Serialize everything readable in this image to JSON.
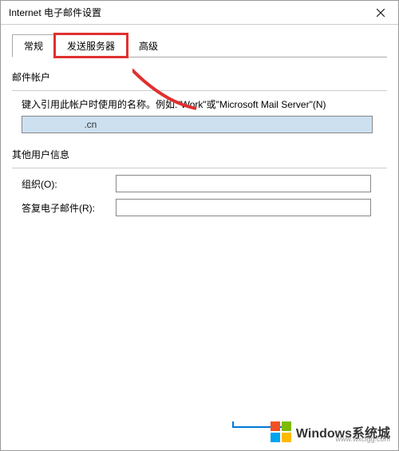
{
  "dialog": {
    "title": "Internet 电子邮件设置"
  },
  "tabs": {
    "general": "常规",
    "send_server": "发送服务器",
    "advanced": "高级"
  },
  "account": {
    "group_title": "邮件帐户",
    "desc": "键入引用此帐户时使用的名称。例如:\"Work\"或\"Microsoft Mail Server\"(N)",
    "name_value": "                      .cn"
  },
  "other": {
    "group_title": "其他用户信息",
    "org_label": "组织(O):",
    "org_value": "",
    "reply_label": "答复电子邮件(R):",
    "reply_value": ""
  },
  "watermark": {
    "brand": "Windows系统城",
    "url": "www.wxclgg.com"
  },
  "colors": {
    "wm_red": "#f25022",
    "wm_green": "#7fba00",
    "wm_blue": "#00a4ef",
    "wm_yellow": "#ffb900"
  }
}
